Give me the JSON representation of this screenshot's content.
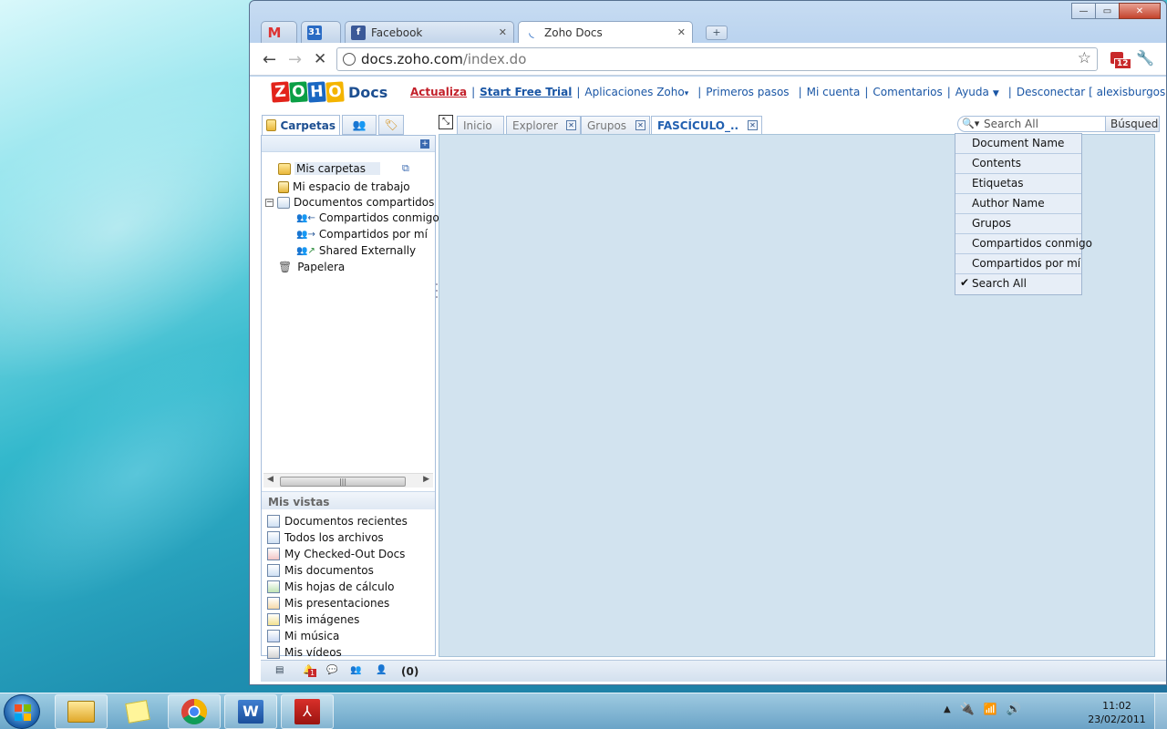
{
  "browser": {
    "tabs": [
      {
        "label": "",
        "icon": "gmail-icon"
      },
      {
        "label": "31",
        "icon": "calendar-icon"
      },
      {
        "label": "Facebook",
        "icon": "facebook-icon"
      },
      {
        "label": "Zoho Docs",
        "icon": "loading-icon"
      }
    ],
    "url_host": "docs.zoho.com",
    "url_path": "/index.do",
    "extension_badge": "12"
  },
  "zoho": {
    "logo_letters": [
      "Z",
      "O",
      "H",
      "O"
    ],
    "logo_suffix": "Docs",
    "logo_colors": [
      "#e2231a",
      "#0a9f45",
      "#1a67c2",
      "#f4b400"
    ],
    "nav": {
      "actualiza": "Actualiza",
      "trial": "Start Free Trial",
      "apps": "Aplicaciones Zoho",
      "primeros": "Primeros pasos",
      "cuenta": "Mi cuenta",
      "comentarios": "Comentarios",
      "ayuda": "Ayuda",
      "desconectar": "Desconectar",
      "user": "[ alexisburgos ]"
    },
    "left_tabs": [
      "Carpetas"
    ],
    "tree": {
      "mis_carpetas": "Mis carpetas",
      "espacio": "Mi espacio de trabajo",
      "compartidos": "Documentos compartidos",
      "conmigo": "Compartidos conmigo",
      "por_mi": "Compartidos por mí",
      "externally": "Shared Externally",
      "papelera": "Papelera"
    },
    "views_title": "Mis vistas",
    "views": [
      "Documentos recientes",
      "Todos los archivos",
      "My Checked-Out Docs",
      "Mis documentos",
      "Mis hojas de cálculo",
      "Mis presentaciones",
      "Mis imágenes",
      "Mi música",
      "Mis vídeos"
    ],
    "content_tabs": [
      "Inicio",
      "Explorer",
      "Grupos",
      "FASCÍCULO_.."
    ],
    "search": {
      "value": "Search All",
      "button": "Búsqueda"
    },
    "search_menu": [
      "Document Name",
      "Contents",
      "Etiquetas",
      "Author Name",
      "Grupos",
      "Compartidos conmigo",
      "Compartidos por mí",
      "Search All"
    ],
    "search_menu_checked": "Search All",
    "notif_badge": "1",
    "chat_count": "(0)"
  },
  "taskbar": {
    "time": "11:02",
    "date": "23/02/2011"
  }
}
